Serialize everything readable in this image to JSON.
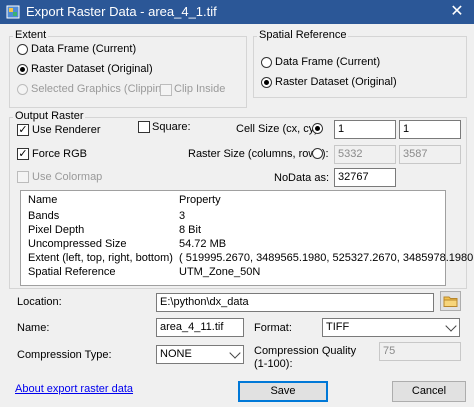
{
  "window": {
    "title": "Export Raster Data - area_4_1.tif",
    "close": "✕"
  },
  "extent": {
    "legend": "Extent",
    "data_frame": "Data Frame (Current)",
    "raster_dataset": "Raster Dataset (Original)",
    "selected_graphics": "Selected Graphics (Clipping)",
    "clip_inside": "Clip Inside"
  },
  "spatial_reference": {
    "legend": "Spatial Reference",
    "data_frame": "Data Frame (Current)",
    "raster_dataset": "Raster Dataset (Original)"
  },
  "output_raster": {
    "legend": "Output Raster",
    "use_renderer": "Use Renderer",
    "force_rgb": "Force RGB",
    "use_colormap": "Use Colormap",
    "square": "Square:",
    "cell_size_label": "Cell Size (cx, cy):",
    "cell_size_x": "1",
    "cell_size_y": "1",
    "raster_size_label": "Raster Size (columns, rows):",
    "raster_cols": "5332",
    "raster_rows": "3587",
    "nodata_label": "NoData as:",
    "nodata_value": "32767"
  },
  "properties": {
    "header": [
      "Name",
      "Property"
    ],
    "rows": [
      [
        "Bands",
        "3"
      ],
      [
        "Pixel Depth",
        "8 Bit"
      ],
      [
        "Uncompressed Size",
        "54.72 MB"
      ],
      [
        "Extent (left, top, right, bottom)",
        "( 519995.2670, 3489565.1980, 525327.2670, 3485978.1980 )"
      ],
      [
        "Spatial Reference",
        "UTM_Zone_50N"
      ]
    ]
  },
  "location": {
    "label": "Location:",
    "value": "E:\\python\\dx_data"
  },
  "name": {
    "label": "Name:",
    "value": "area_4_11.tif"
  },
  "format": {
    "label": "Format:",
    "value": "TIFF"
  },
  "compression_type": {
    "label": "Compression Type:",
    "value": "NONE"
  },
  "compression_quality": {
    "label": "Compression Quality",
    "label2": "(1-100):",
    "value": "75"
  },
  "footer": {
    "about_link": "About export raster data",
    "save": "Save",
    "cancel": "Cancel"
  },
  "icons": {
    "folder": "folder-icon",
    "app": "app-icon"
  }
}
